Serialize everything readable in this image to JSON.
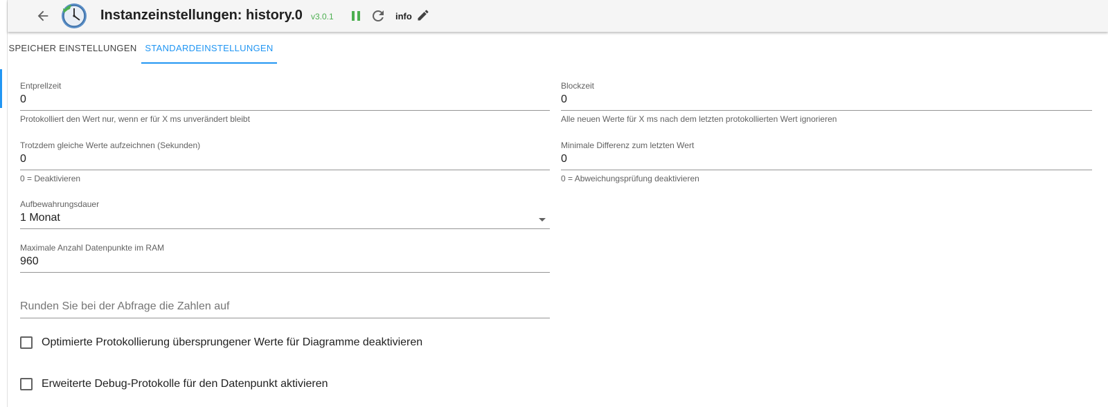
{
  "header": {
    "title": "Instanzeinstellungen: history.0",
    "version": "v3.0.1",
    "info_label": "info",
    "icons": {
      "back": "arrow-left-icon",
      "logo": "history-clock-icon",
      "pause": "pause-icon",
      "reload": "reload-icon",
      "edit": "pencil-icon"
    },
    "colors": {
      "version": "#4caf50",
      "pause": "#4caf50"
    }
  },
  "tabs": [
    {
      "label": "SPEICHER EINSTELLUNGEN",
      "active": false
    },
    {
      "label": "STANDARDEINSTELLUNGEN",
      "active": true
    }
  ],
  "accent_color": "#2196f3",
  "form": {
    "debounce": {
      "label": "Entprellzeit",
      "value": "0",
      "helper": "Protokolliert den Wert nur, wenn er für X ms unverändert bleibt"
    },
    "blocktime": {
      "label": "Blockzeit",
      "value": "0",
      "helper": "Alle neuen Werte für X ms nach dem letzten protokollierten Wert ignorieren"
    },
    "change_only": {
      "label": "Trotzdem gleiche Werte aufzeichnen (Sekunden)",
      "value": "0",
      "helper": "0 = Deaktivieren"
    },
    "min_diff": {
      "label": "Minimale Differenz zum letzten Wert",
      "value": "0",
      "helper": "0 = Abweichungsprüfung deaktivieren"
    },
    "retention": {
      "label": "Aufbewahrungsdauer",
      "value": "1 Monat"
    },
    "max_points": {
      "label": "Maximale Anzahl Datenpunkte im RAM",
      "value": "960"
    },
    "round": {
      "placeholder": "Runden Sie bei der Abfrage die Zahlen auf"
    },
    "checkboxes": [
      {
        "label": "Optimierte Protokollierung übersprungener Werte für Diagramme deaktivieren",
        "checked": false
      },
      {
        "label": "Erweiterte Debug-Protokolle für den Datenpunkt aktivieren",
        "checked": false
      }
    ]
  }
}
